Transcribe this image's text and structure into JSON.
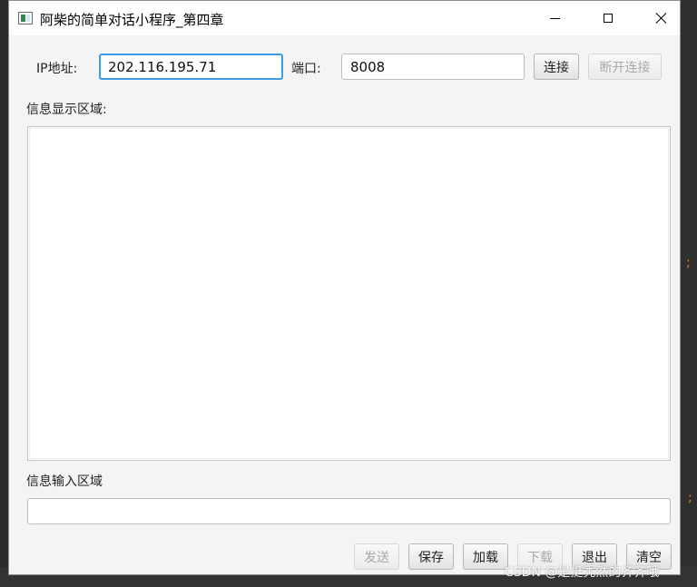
{
  "window": {
    "title": "阿柴的简单对话小程序_第四章",
    "minimize_label": "minimize",
    "maximize_label": "maximize",
    "close_label": "close"
  },
  "connection": {
    "ip_label": "IP地址:",
    "ip_value": "202.116.195.71",
    "port_label": "端口:",
    "port_value": "8008",
    "connect_label": "连接",
    "disconnect_label": "断开连接"
  },
  "display": {
    "label": "信息显示区域:"
  },
  "input": {
    "label": "信息输入区域",
    "value": ""
  },
  "actions": {
    "send_label": "发送",
    "save_label": "保存",
    "load_label": "加载",
    "download_label": "下载",
    "exit_label": "退出",
    "clear_label": "清空"
  },
  "background": {
    "accent_color": "#d38b2a",
    "marks": [
      ";",
      ";"
    ]
  },
  "watermark": {
    "text": "CSDN @是挺秃然的齐齐哦"
  },
  "colors": {
    "focus_border": "#3c9ce8",
    "disabled_text": "#a9a9a9"
  }
}
